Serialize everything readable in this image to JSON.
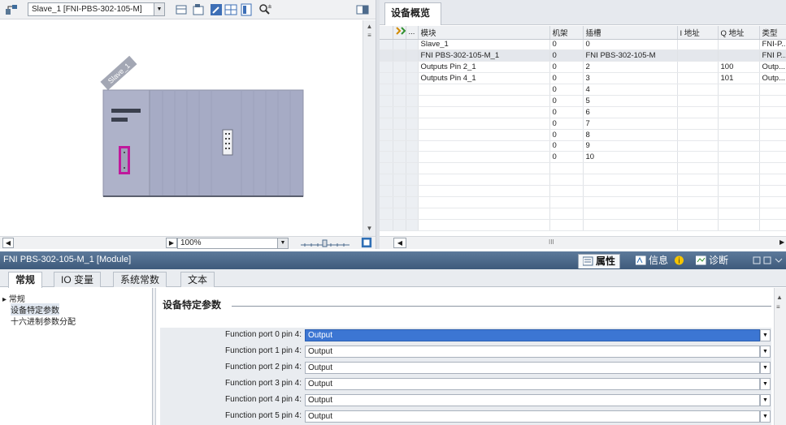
{
  "device_view": {
    "device_selector": "Slave_1 [FNI-PBS-302-105-M]",
    "device_label": "Slave_1",
    "zoom": "100%"
  },
  "device_overview": {
    "tab": "设备概览",
    "columns": [
      "模块",
      "机架",
      "插槽",
      "I 地址",
      "Q 地址",
      "类型"
    ],
    "rows": [
      {
        "module": "Slave_1",
        "rack": "0",
        "slot": "0",
        "i_addr": "",
        "q_addr": "",
        "type": "FNI-P..."
      },
      {
        "module": "FNI PBS-302-105-M_1",
        "rack": "0",
        "slot": "FNI PBS-302-105-M",
        "i_addr": "",
        "q_addr": "",
        "type": "FNI P..."
      },
      {
        "module": "Outputs Pin 2_1",
        "rack": "0",
        "slot": "2",
        "i_addr": "",
        "q_addr": "100",
        "type": "Outp..."
      },
      {
        "module": "Outputs Pin 4_1",
        "rack": "0",
        "slot": "3",
        "i_addr": "",
        "q_addr": "101",
        "type": "Outp..."
      },
      {
        "module": "",
        "rack": "0",
        "slot": "4",
        "i_addr": "",
        "q_addr": "",
        "type": ""
      },
      {
        "module": "",
        "rack": "0",
        "slot": "5",
        "i_addr": "",
        "q_addr": "",
        "type": ""
      },
      {
        "module": "",
        "rack": "0",
        "slot": "6",
        "i_addr": "",
        "q_addr": "",
        "type": ""
      },
      {
        "module": "",
        "rack": "0",
        "slot": "7",
        "i_addr": "",
        "q_addr": "",
        "type": ""
      },
      {
        "module": "",
        "rack": "0",
        "slot": "8",
        "i_addr": "",
        "q_addr": "",
        "type": ""
      },
      {
        "module": "",
        "rack": "0",
        "slot": "9",
        "i_addr": "",
        "q_addr": "",
        "type": ""
      },
      {
        "module": "",
        "rack": "0",
        "slot": "10",
        "i_addr": "",
        "q_addr": "",
        "type": ""
      },
      {
        "module": "",
        "rack": "",
        "slot": "",
        "i_addr": "",
        "q_addr": "",
        "type": ""
      },
      {
        "module": "",
        "rack": "",
        "slot": "",
        "i_addr": "",
        "q_addr": "",
        "type": ""
      },
      {
        "module": "",
        "rack": "",
        "slot": "",
        "i_addr": "",
        "q_addr": "",
        "type": ""
      },
      {
        "module": "",
        "rack": "",
        "slot": "",
        "i_addr": "",
        "q_addr": "",
        "type": ""
      },
      {
        "module": "",
        "rack": "",
        "slot": "",
        "i_addr": "",
        "q_addr": "",
        "type": ""
      },
      {
        "module": "",
        "rack": "",
        "slot": "",
        "i_addr": "",
        "q_addr": "",
        "type": ""
      }
    ],
    "scroll_marker": "III"
  },
  "properties": {
    "title": "FNI PBS-302-105-M_1 [Module]",
    "header_tabs": {
      "properties": "属性",
      "info": "信息",
      "diagnostics": "诊断"
    },
    "tabs": [
      "常规",
      "IO 变量",
      "系统常数",
      "文本"
    ],
    "nav": {
      "general": "常规",
      "device_params": "设备特定参数",
      "hex_params": "十六进制参数分配"
    },
    "section_title": "设备特定参数",
    "params": [
      {
        "label": "Function port 0 pin 4:",
        "value": "Output"
      },
      {
        "label": "Function port 1 pin 4:",
        "value": "Output"
      },
      {
        "label": "Function port 2 pin 4:",
        "value": "Output"
      },
      {
        "label": "Function port 3 pin 4:",
        "value": "Output"
      },
      {
        "label": "Function port 4 pin 4:",
        "value": "Output"
      },
      {
        "label": "Function port 5 pin 4:",
        "value": "Output"
      }
    ]
  },
  "colors": {
    "header_bar": "#4c6a8c",
    "selection_blue": "#3c76d3",
    "module_body": "#a8aec8",
    "connector_magenta": "#c0199c"
  }
}
